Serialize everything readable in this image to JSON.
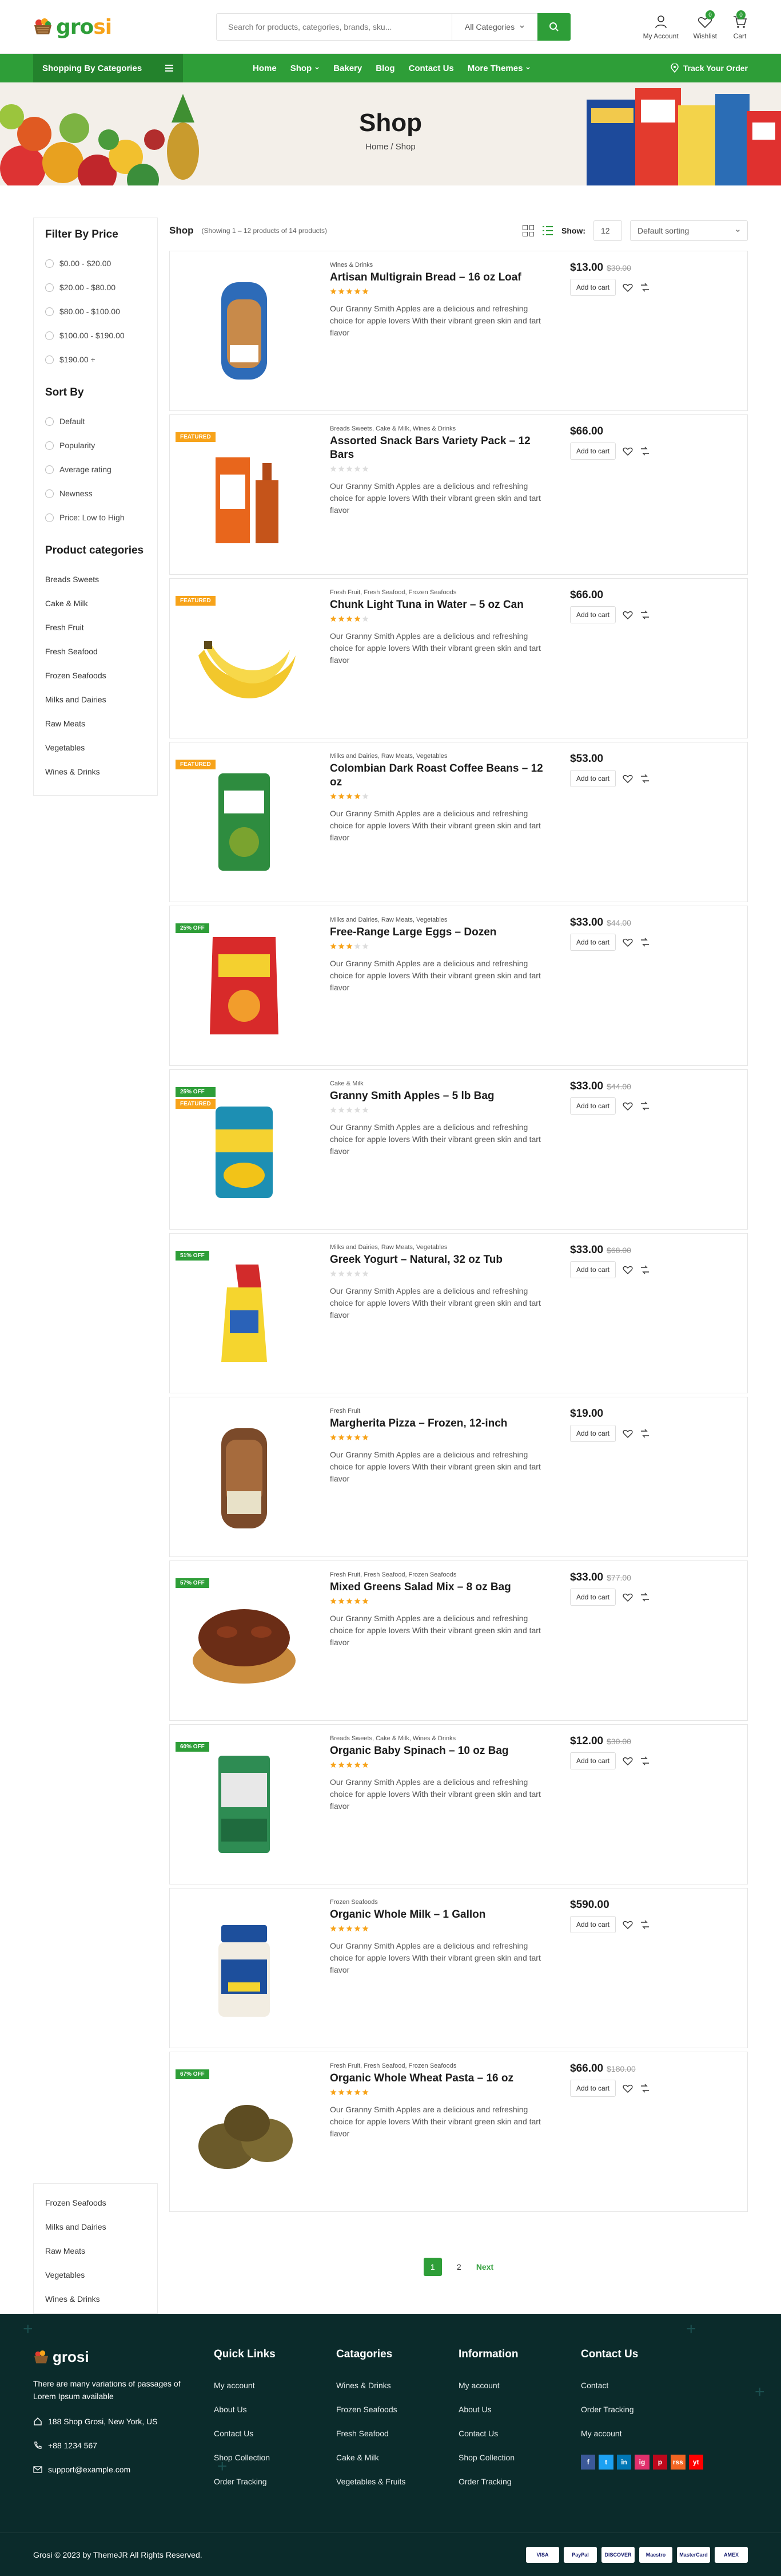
{
  "header": {
    "logo_left": "gro",
    "logo_right": "si",
    "search_placeholder": "Search for products, categories, brands, sku...",
    "search_category": "All Categories",
    "account": "My Account",
    "wishlist": "Wishlist",
    "wishlist_count": "0",
    "cart": "Cart",
    "cart_count": "0"
  },
  "nav": {
    "categories_button": "Shopping By Categories",
    "items": [
      "Home",
      "Shop",
      "Bakery",
      "Blog",
      "Contact Us",
      "More Themes"
    ],
    "track": "Track Your Order"
  },
  "banner": {
    "title": "Shop",
    "crumb_home": "Home",
    "crumb_sep": "/",
    "crumb_current": "Shop"
  },
  "sidebar": {
    "price_title": "Filter By Price",
    "prices": [
      "$0.00 - $20.00",
      "$20.00 - $80.00",
      "$80.00 - $100.00",
      "$100.00 - $190.00",
      "$190.00 +"
    ],
    "sort_title": "Sort By",
    "sorts": [
      "Default",
      "Popularity",
      "Average rating",
      "Newness",
      "Price: Low to High"
    ],
    "cat_title": "Product categories",
    "categories": [
      "Breads Sweets",
      "Cake & Milk",
      "Fresh Fruit",
      "Fresh Seafood",
      "Frozen Seafoods",
      "Milks and Dairies",
      "Raw Meats",
      "Vegetables",
      "Wines & Drinks"
    ],
    "bottom_categories": [
      "Frozen Seafoods",
      "Milks and Dairies",
      "Raw Meats",
      "Vegetables",
      "Wines & Drinks"
    ]
  },
  "toolbar": {
    "title": "Shop",
    "count": "(Showing 1 – 12 products of 14 products)",
    "show_label": "Show:",
    "show_value": "12",
    "sort_value": "Default sorting"
  },
  "product_common": {
    "description": "Our Granny Smith Apples are a delicious and refreshing choice for apple lovers With their vibrant green skin and tart flavor",
    "add_to_cart": "Add to cart"
  },
  "products": [
    {
      "cats": "Wines & Drinks",
      "name": "Artisan Multigrain Bread – 16 oz Loaf",
      "price": "$13.00",
      "old": "$30.00",
      "rating": 5,
      "tags": [],
      "img": "bread"
    },
    {
      "cats": "Breads Sweets, Cake & Milk, Wines & Drinks",
      "name": "Assorted Snack Bars Variety Pack – 12 Bars",
      "price": "$66.00",
      "old": "",
      "rating": 0,
      "tags": [
        "FEATURED"
      ],
      "img": "whisky"
    },
    {
      "cats": "Fresh Fruit, Fresh Seafood, Frozen Seafoods",
      "name": "Chunk Light Tuna in Water – 5 oz Can",
      "price": "$66.00",
      "old": "",
      "rating": 4,
      "tags": [
        "FEATURED"
      ],
      "img": "banana"
    },
    {
      "cats": "Milks and Dairies, Raw Meats, Vegetables",
      "name": "Colombian Dark Roast Coffee Beans – 12 oz",
      "price": "$53.00",
      "old": "",
      "rating": 4,
      "tags": [
        "FEATURED"
      ],
      "img": "grain"
    },
    {
      "cats": "Milks and Dairies, Raw Meats, Vegetables",
      "name": "Free-Range Large Eggs – Dozen",
      "price": "$33.00",
      "old": "$44.00",
      "rating": 3,
      "tags": [
        "25% OFF"
      ],
      "img": "chips"
    },
    {
      "cats": "Cake & Milk",
      "name": "Granny Smith Apples – 5 lb Bag",
      "price": "$33.00",
      "old": "$44.00",
      "rating": 0,
      "tags": [
        "25% OFF",
        "FEATURED"
      ],
      "img": "can"
    },
    {
      "cats": "Milks and Dairies, Raw Meats, Vegetables",
      "name": "Greek Yogurt – Natural, 32 oz Tub",
      "price": "$33.00",
      "old": "$68.00",
      "rating": 0,
      "tags": [
        "51% OFF"
      ],
      "img": "cleaner"
    },
    {
      "cats": "Fresh Fruit",
      "name": "Margherita Pizza – Frozen, 12-inch",
      "price": "$19.00",
      "old": "",
      "rating": 5,
      "tags": [],
      "img": "loaf"
    },
    {
      "cats": "Fresh Fruit, Fresh Seafood, Frozen Seafoods",
      "name": "Mixed Greens Salad Mix – 8 oz Bag",
      "price": "$33.00",
      "old": "$77.00",
      "rating": 5,
      "tags": [
        "57% OFF"
      ],
      "img": "dates"
    },
    {
      "cats": "Breads Sweets, Cake & Milk, Wines & Drinks",
      "name": "Organic Baby Spinach – 10 oz Bag",
      "price": "$12.00",
      "old": "$30.00",
      "rating": 5,
      "tags": [
        "60% OFF"
      ],
      "img": "tin"
    },
    {
      "cats": "Frozen Seafoods",
      "name": "Organic Whole Milk – 1 Gallon",
      "price": "$590.00",
      "old": "",
      "rating": 5,
      "tags": [],
      "img": "jar"
    },
    {
      "cats": "Fresh Fruit, Fresh Seafood, Frozen Seafoods",
      "name": "Organic Whole Wheat Pasta – 16 oz",
      "price": "$66.00",
      "old": "$180.00",
      "rating": 5,
      "tags": [
        "67% OFF"
      ],
      "img": "kiwi"
    }
  ],
  "pagination": {
    "pages": [
      "1",
      "2"
    ],
    "next": "Next"
  },
  "footer": {
    "logo": "grosi",
    "about": "There are many variations of passages of Lorem Ipsum available",
    "address": "188 Shop Grosi, New York, US",
    "phone": "+88 1234 567",
    "email": "support@example.com",
    "columns": [
      {
        "title": "Quick Links",
        "links": [
          "My account",
          "About Us",
          "Contact Us",
          "Shop Collection",
          "Order Tracking"
        ]
      },
      {
        "title": "Catagories",
        "links": [
          "Wines & Drinks",
          "Frozen Seafoods",
          "Fresh Seafood",
          "Cake & Milk",
          "Vegetables & Fruits"
        ]
      },
      {
        "title": "Information",
        "links": [
          "My account",
          "About Us",
          "Contact Us",
          "Shop Collection",
          "Order Tracking"
        ]
      },
      {
        "title": "Contact Us",
        "links": [
          "Contact",
          "Order Tracking",
          "My account"
        ]
      }
    ],
    "social": [
      "f",
      "t",
      "in",
      "ig",
      "p",
      "rss",
      "yt"
    ],
    "copyright": "Grosi © 2023 by ThemeJR All Rights Reserved.",
    "payments": [
      "VISA",
      "PayPal",
      "DISCOVER",
      "Maestro",
      "MasterCard",
      "AMEX"
    ]
  },
  "colors": {
    "brand": "#2e9e38",
    "accent": "#f7a31a",
    "footer": "#0b2b2b"
  }
}
